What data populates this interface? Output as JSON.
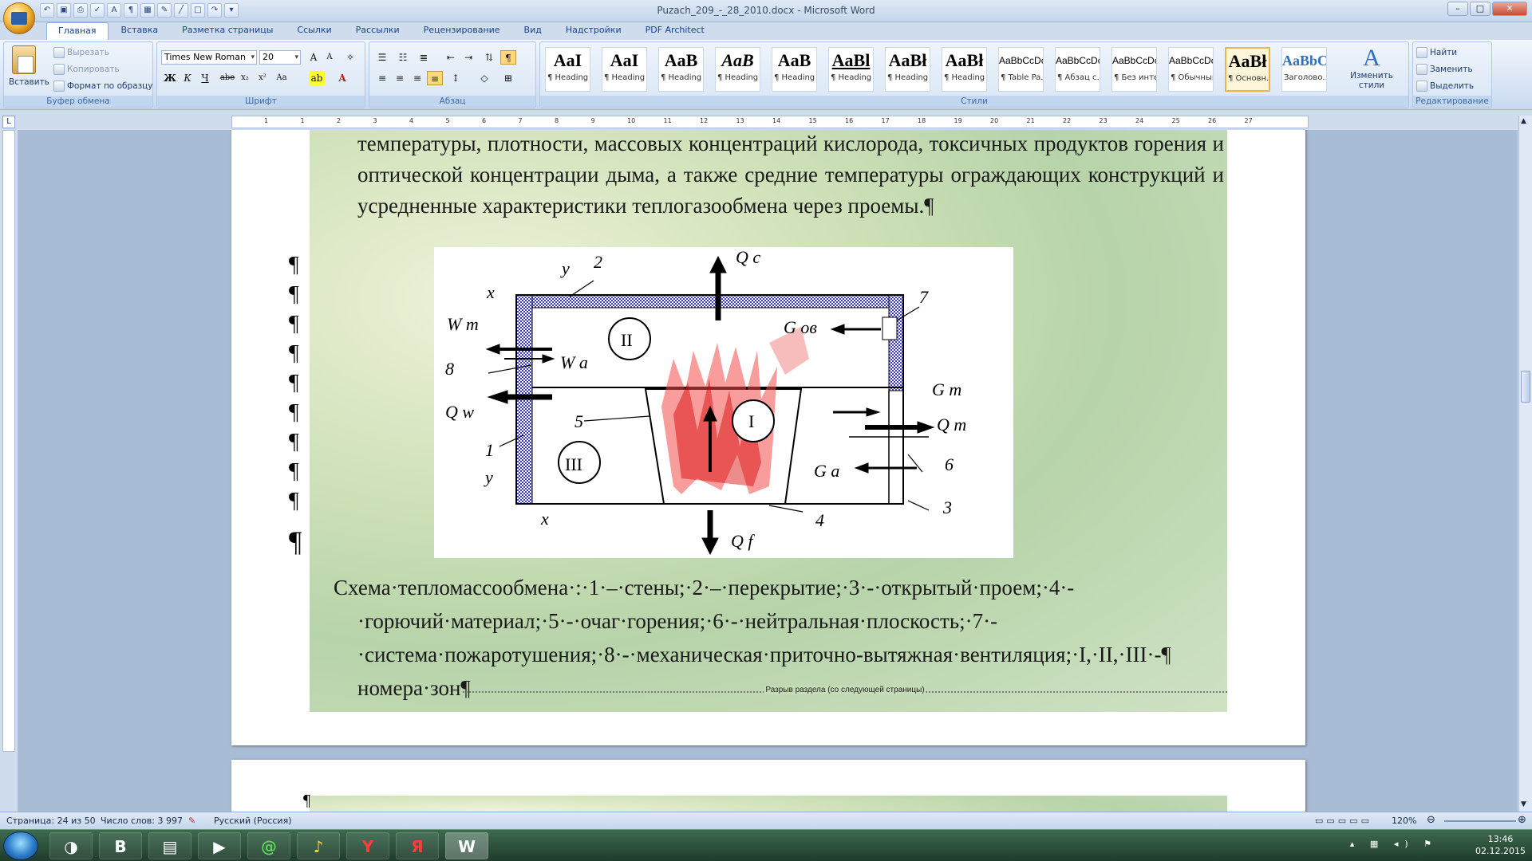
{
  "window": {
    "title": "Puzach_209_-_28_2010.docx - Microsoft Word"
  },
  "tabs": [
    "Главная",
    "Вставка",
    "Разметка страницы",
    "Ссылки",
    "Рассылки",
    "Рецензирование",
    "Вид",
    "Надстройки",
    "PDF Architect"
  ],
  "clipboard": {
    "paste": "Вставить",
    "cut": "Вырезать",
    "copy": "Копировать",
    "format_painter": "Формат по образцу",
    "label": "Буфер обмена"
  },
  "font": {
    "name": "Times New Roman",
    "size": "20",
    "label": "Шрифт",
    "bold": "Ж",
    "italic": "К",
    "underline": "Ч",
    "strike": "abe",
    "sub": "x₂",
    "sup": "x²",
    "case": "Aa"
  },
  "paragraph": {
    "label": "Абзац"
  },
  "styles": {
    "label": "Стили",
    "items": [
      {
        "sample": "AaI",
        "name": "¶ Heading 1"
      },
      {
        "sample": "AaI",
        "name": "¶ Heading 2"
      },
      {
        "sample": "AaB",
        "name": "¶ Heading 3"
      },
      {
        "sample": "AaB",
        "name": "¶ Heading 4"
      },
      {
        "sample": "AaB",
        "name": "¶ Heading 5"
      },
      {
        "sample": "AaBl",
        "name": "¶ Heading 6"
      },
      {
        "sample": "AaBł",
        "name": "¶ Heading 7"
      },
      {
        "sample": "AaBł",
        "name": "¶ Heading 8"
      },
      {
        "sample": "AaBbCcDc",
        "name": "¶ Table Pa..."
      },
      {
        "sample": "AaBbCcDc",
        "name": "¶ Абзац с..."
      },
      {
        "sample": "AaBbCcDc",
        "name": "¶ Без инте..."
      },
      {
        "sample": "AaBbCcDc",
        "name": "¶ Обычный"
      },
      {
        "sample": "AaBł",
        "name": "¶ Основн..."
      },
      {
        "sample": "AaBbC",
        "name": "Заголово..."
      }
    ],
    "change": "Изменить стили"
  },
  "editing": {
    "find": "Найти",
    "replace": "Заменить",
    "select": "Выделить",
    "label": "Редактирование"
  },
  "ruler_numbers": [
    "1",
    "1",
    "2",
    "3",
    "4",
    "5",
    "6",
    "7",
    "8",
    "9",
    "10",
    "11",
    "12",
    "13",
    "14",
    "15",
    "16",
    "17",
    "18",
    "19",
    "20",
    "21",
    "22",
    "23",
    "24",
    "25",
    "26",
    "27"
  ],
  "doc": {
    "para_top": "температуры, плотности, массовых концентраций кислорода, токсичных продуктов горения и оптической концентрации дыма, а также средние температуры ограждающих конструкций и усредненные характеристики теплогазообмена через проемы.¶",
    "pilcrow": "¶",
    "caption_lead": "Схема теплομассообмена",
    "caption_text": "Схема·тепломассообмена·:·1·–·стены;·2·–·перекрытие;·3·-·открытый·проем;·4·-·горючий·материал;·5·-·очаг·горения;·6·-·нейтральная·плоскость;·7·-·система·пожаротушения;·8·-·механическая·приточно-вытяжная·вентиляция;·I,·II,·III·-¶ номера·зон¶",
    "section_break": "Разрыв раздела (со следующей страницы)",
    "page2_pilcrow": "¶"
  },
  "figure": {
    "labels": {
      "y_top": "y",
      "n2": "2",
      "qc": "Q c",
      "x_left": "x",
      "n7": "7",
      "wm": "W m",
      "zone2": "II",
      "gov": "G ов",
      "n8": "8",
      "wa": "W a",
      "gm": "G m",
      "qw": "Q w",
      "zone1": "I",
      "n5": "5",
      "qm": "Q m",
      "n1": "1",
      "zone3": "III",
      "n6": "6",
      "y_bottom": "y",
      "ga": "G a",
      "n3": "3",
      "x_bottom": "x",
      "n4": "4",
      "qf": "Q f"
    }
  },
  "status": {
    "page": "Страница: 24 из 50",
    "words": "Число слов: 3 997",
    "lang": "Русский (Россия)",
    "zoom": "120%"
  },
  "taskbar": {
    "time": "13:46",
    "date": "02.12.2015",
    "items": [
      "B",
      "Я"
    ]
  }
}
